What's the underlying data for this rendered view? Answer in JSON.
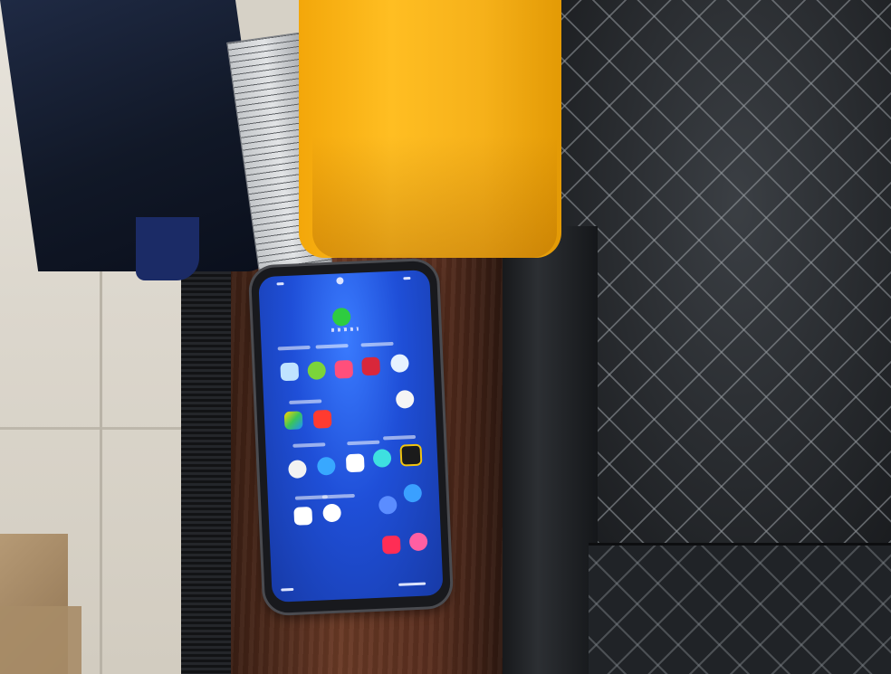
{
  "scene": {
    "description_free": true,
    "colors": {
      "yellow_block": "#ffbe22",
      "leather": "#1c1e21",
      "wood": "#6a3a26",
      "phone_screen": "#1f4fd8"
    },
    "icons": [
      "phone-app-icon",
      "settings-icon",
      "youtube-icon",
      "message-icon"
    ]
  }
}
